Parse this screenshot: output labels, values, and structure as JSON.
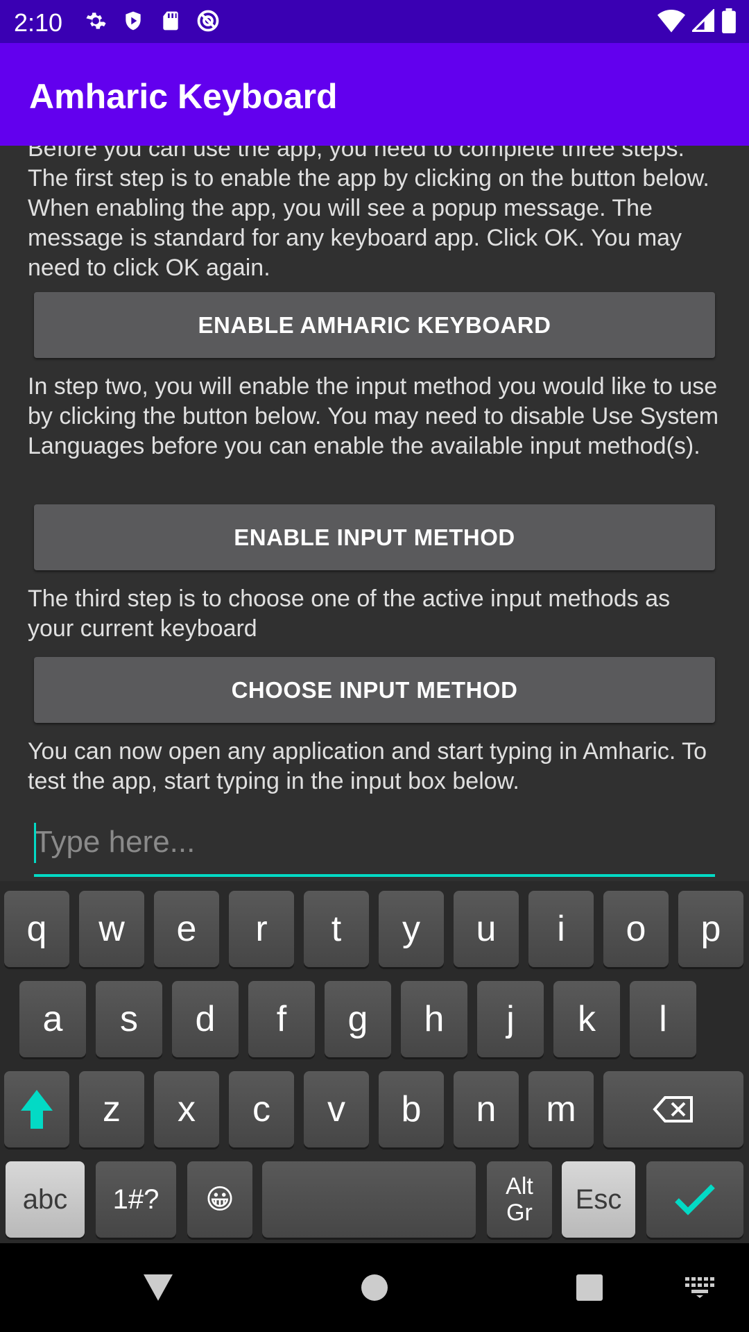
{
  "status_bar": {
    "time": "2:10",
    "left_icons": [
      "settings-gear-icon",
      "shield-play-icon",
      "sd-card-icon",
      "no-sync-icon"
    ],
    "right_icons": [
      "wifi-icon",
      "cell-signal-icon",
      "battery-icon"
    ]
  },
  "app_bar": {
    "title": "Amharic Keyboard"
  },
  "content": {
    "step1_text": "Before you can use the app, you need to complete three steps. The first step is to enable the app by clicking on the button below. When enabling the app, you will see a popup message. The message is standard for any keyboard app. Click OK. You may need to click OK again.",
    "enable_keyboard_label": "ENABLE AMHARIC KEYBOARD",
    "step2_text": "In step two, you will enable the input method you would like to use by clicking the button below. You may need to disable Use System Languages before you can enable the available input method(s).",
    "enable_input_method_label": "ENABLE INPUT METHOD",
    "step3_text": "The third step is to choose one of the active input methods as your current keyboard",
    "choose_input_method_label": "CHOOSE INPUT METHOD",
    "step4_text": "You can now open any application and start typing in Amharic. To test the app, start typing in the input box below.",
    "test_input": {
      "value": "",
      "placeholder": "Type here..."
    }
  },
  "keyboard": {
    "row1": [
      "q",
      "w",
      "e",
      "r",
      "t",
      "y",
      "u",
      "i",
      "o",
      "p"
    ],
    "row2": [
      "a",
      "s",
      "d",
      "f",
      "g",
      "h",
      "j",
      "k",
      "l"
    ],
    "row3": [
      "z",
      "x",
      "c",
      "v",
      "b",
      "n",
      "m"
    ],
    "abc_label": "abc",
    "symbols_label": "1#?",
    "emoji": "😀",
    "altgr_label_1": "Alt",
    "altgr_label_2": "Gr",
    "esc_label": "Esc",
    "accent_color": "#03dac5"
  },
  "nav_bar": {
    "icons": [
      "back-icon",
      "home-icon",
      "recents-icon",
      "keyboard-switch-icon"
    ]
  },
  "colors": {
    "status_bar": "#3a00b3",
    "app_bar": "#6200ee",
    "background": "#303030",
    "button": "#5a5a5c"
  }
}
